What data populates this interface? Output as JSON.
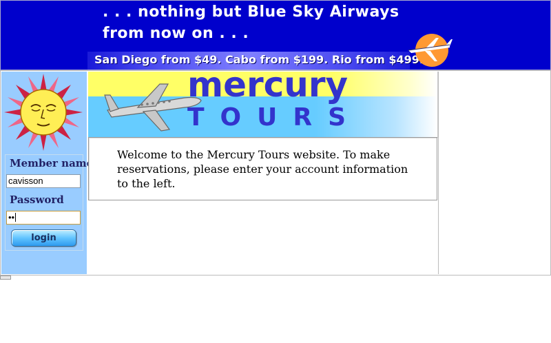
{
  "banner": {
    "line1": ". . . nothing but Blue Sky Airways",
    "line2": "from now on . . .",
    "deals": "San Diego from $49. Cabo from $199. Rio from $499."
  },
  "login": {
    "member_label": "Member name",
    "member_value": "cavisson",
    "password_label": "Password",
    "password_value": "••",
    "button_label": "login"
  },
  "header": {
    "mercury": "mercury",
    "tours": "TOURS"
  },
  "welcome": {
    "text": "Welcome to the Mercury Tours website. To make reservations, please enter your account information to the left."
  },
  "colors": {
    "banner_bg": "#0000cc",
    "sidebar_bg": "#99ccff",
    "logo_text": "#3333cc",
    "header_yellow": "#ffff66",
    "header_blue": "#66ccff"
  }
}
